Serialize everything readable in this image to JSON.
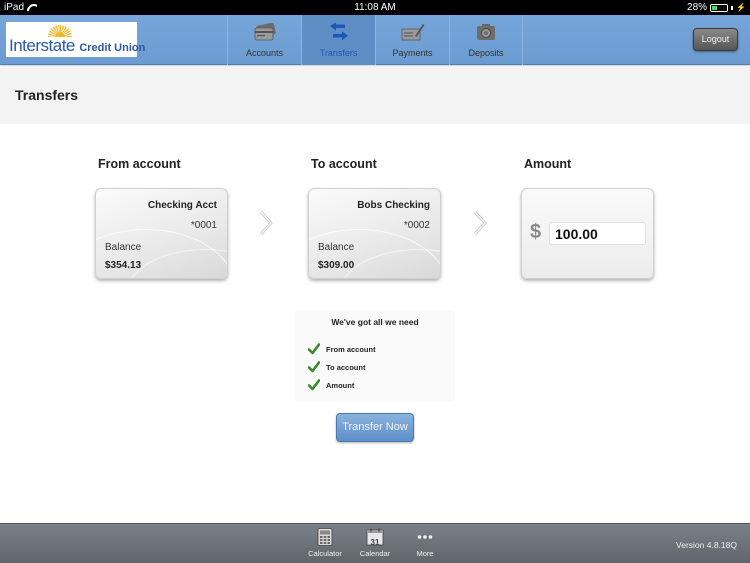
{
  "status_bar": {
    "device": "iPad",
    "time": "11:08 AM",
    "battery": "28%",
    "battery_level": 0.28
  },
  "header": {
    "logo_text_main": "Interstate",
    "logo_text_sub": "Credit Union",
    "tabs": [
      {
        "label": "Accounts",
        "icon": "credit-card-icon",
        "active": false
      },
      {
        "label": "Transfers",
        "icon": "transfer-arrows-icon",
        "active": true
      },
      {
        "label": "Payments",
        "icon": "check-pen-icon",
        "active": false
      },
      {
        "label": "Deposits",
        "icon": "camera-icon",
        "active": false
      }
    ],
    "logout_label": "Logout",
    "accent_color": "#6b9bd0"
  },
  "page": {
    "title": "Transfers"
  },
  "from_account": {
    "label": "From account",
    "name": "Checking Acct",
    "number": "*0001",
    "balance_label": "Balance",
    "balance": "$354.13"
  },
  "to_account": {
    "label": "To account",
    "name": "Bobs Checking",
    "number": "*0002",
    "balance_label": "Balance",
    "balance": "$309.00"
  },
  "amount": {
    "label": "Amount",
    "currency_symbol": "$",
    "value": "100.00"
  },
  "checklist": {
    "heading": "We've got all we need",
    "items": [
      {
        "label": "From account",
        "checked": true
      },
      {
        "label": "To account",
        "checked": true
      },
      {
        "label": "Amount",
        "checked": true
      }
    ],
    "check_color": "#3a8a2a"
  },
  "transfer_button_label": "Transfer Now",
  "footer": {
    "items": [
      {
        "label": "Calculator",
        "icon": "calculator-icon"
      },
      {
        "label": "Calendar",
        "icon": "calendar-icon",
        "day": "31"
      },
      {
        "label": "More",
        "icon": "more-dots-icon"
      }
    ],
    "version": "Version 4.8.18Q"
  }
}
